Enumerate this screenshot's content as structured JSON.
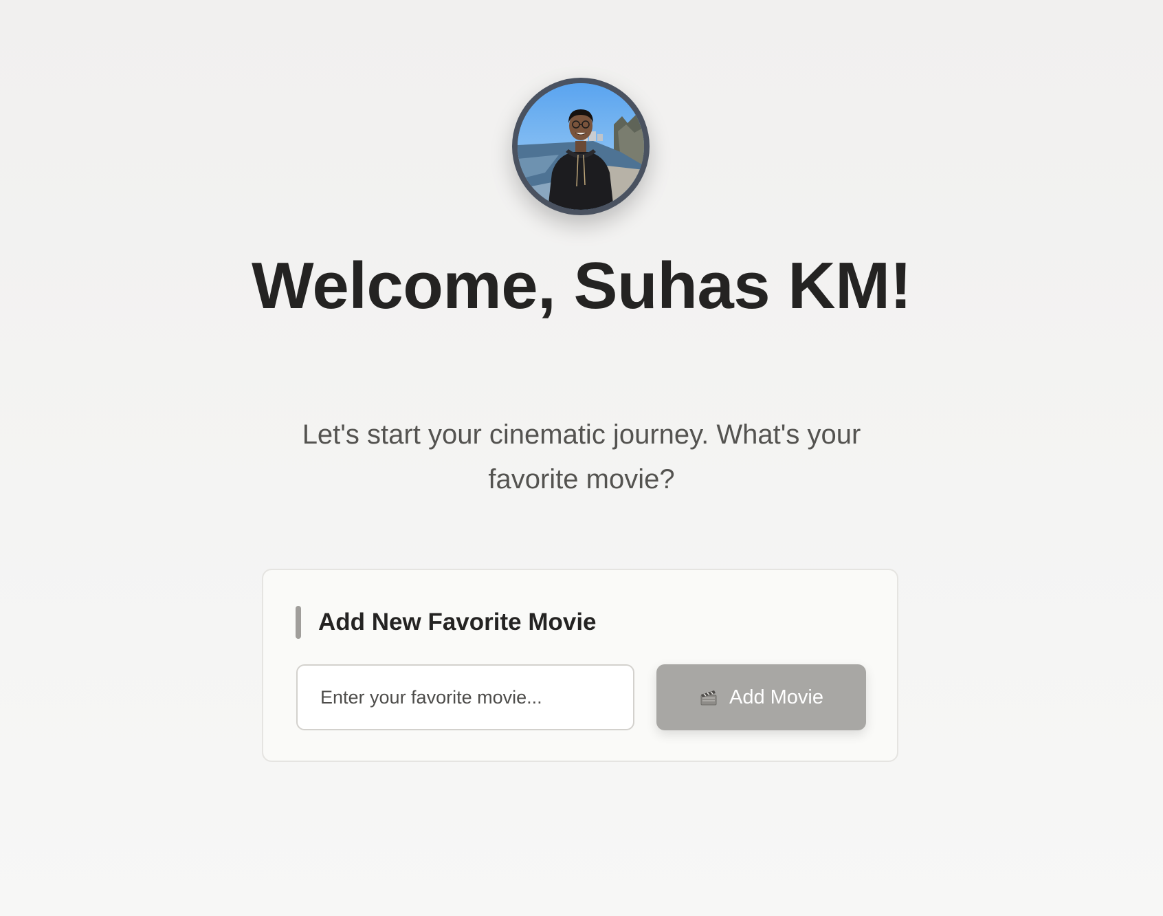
{
  "profile": {
    "avatar_alt": "Profile photo",
    "border_color": "#4a5260"
  },
  "welcome": {
    "title": "Welcome, Suhas KM!",
    "subtitle": "Let's start your cinematic journey. What's your favorite movie?"
  },
  "add_movie_card": {
    "title": "Add New Favorite Movie",
    "input_placeholder": "Enter your favorite movie...",
    "input_value": "",
    "button_label": "Add Movie",
    "button_icon": "clapperboard-icon",
    "button_color": "#a8a7a4",
    "accent_color": "#a09e9b"
  }
}
